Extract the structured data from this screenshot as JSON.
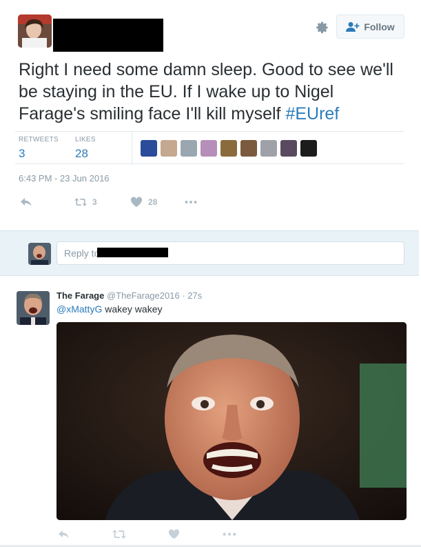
{
  "tweet": {
    "text_main": "Right I need some damn sleep. Good to see we'll be staying in the EU. If I wake up to Nigel Farage's smiling face I'll kill myself ",
    "hashtag": "#EUref",
    "follow_label": "Follow",
    "retweets_label": "RETWEETS",
    "retweets_count": "3",
    "likes_label": "LIKES",
    "likes_count": "28",
    "timestamp": "6:43 PM - 23 Jun 2016",
    "action_retweet_count": "3",
    "action_like_count": "28",
    "liker_colors": [
      "#2a4c9a",
      "#c4a890",
      "#9aa6b0",
      "#b68fb8",
      "#8a6b3c",
      "#7b5a3e",
      "#9ea1a8",
      "#5a4a60",
      "#1c1c1c"
    ]
  },
  "reply_box": {
    "placeholder": "Reply to"
  },
  "reply": {
    "name": "The Farage",
    "handle": "@TheFarage2016",
    "separator": "·",
    "time": "27s",
    "mention": "@xMattyG",
    "text": " wakey wakey"
  },
  "icons": {
    "settings": "gear-icon",
    "follow": "add-user-icon",
    "reply": "reply-icon",
    "retweet": "retweet-icon",
    "like": "heart-icon",
    "more": "more-dots-icon"
  }
}
